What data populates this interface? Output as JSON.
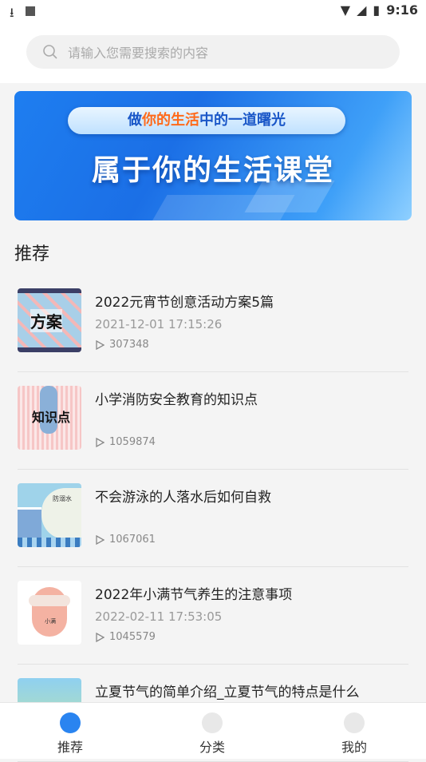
{
  "status_bar": {
    "time": "9:16"
  },
  "search": {
    "placeholder": "请输入您需要搜索的内容"
  },
  "banner": {
    "pill_pre": "做",
    "pill_hl": "你的生活",
    "pill_post": "中的一道曙光",
    "headline": "属于你的生活课堂"
  },
  "section": {
    "title": "推荐"
  },
  "items": [
    {
      "title": "2022元宵节创意活动方案5篇",
      "date": "2021-12-01 17:15:26",
      "views": "307348",
      "thumb_text": "方案"
    },
    {
      "title": "小学消防安全教育的知识点",
      "date": "",
      "views": "1059874",
      "thumb_text": "知识点"
    },
    {
      "title": "不会游泳的人落水后如何自救",
      "date": "",
      "views": "1067061",
      "thumb_text": "防溺水"
    },
    {
      "title": "2022年小满节气养生的注意事项",
      "date": "2022-02-11 17:53:05",
      "views": "1045579",
      "thumb_text": "小满"
    },
    {
      "title": "立夏节气的简单介绍_立夏节气的特点是什么",
      "date": "",
      "views": "",
      "thumb_text": ""
    }
  ],
  "tabs": [
    {
      "label": "推荐"
    },
    {
      "label": "分类"
    },
    {
      "label": "我的"
    }
  ]
}
